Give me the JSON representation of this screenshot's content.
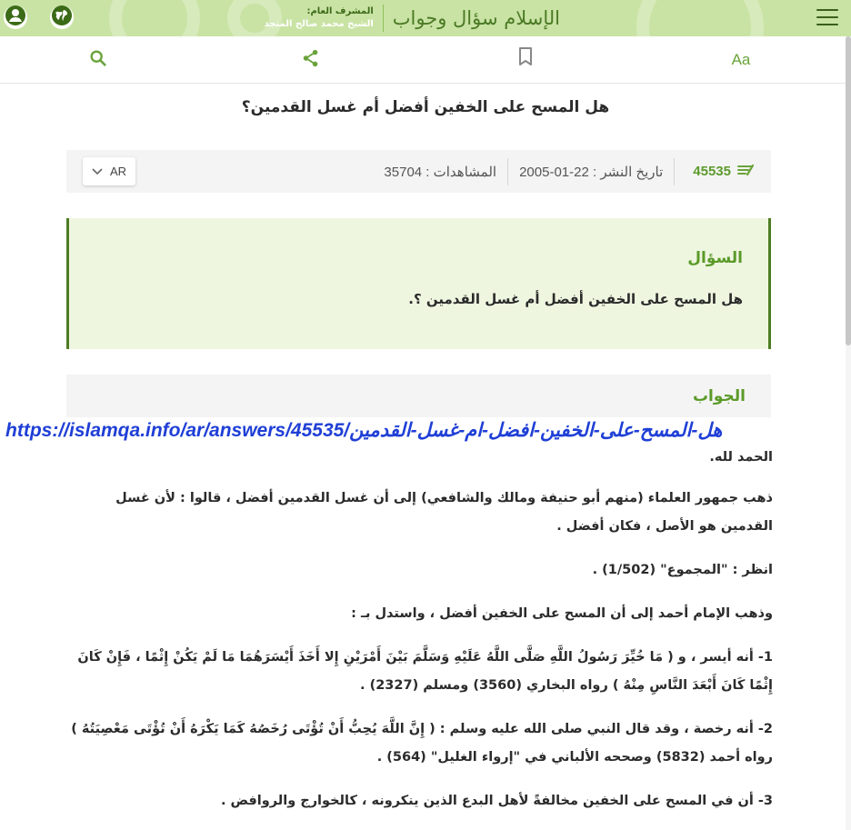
{
  "header": {
    "logo_text": "الإسلام سؤال وجواب",
    "supervisor_label": "المشرف العام:",
    "supervisor_name": "الشيخ محمد صالح المنجد"
  },
  "toolbar": {
    "font_size_label": "Aa"
  },
  "article": {
    "title": "هل المسح على الخفين أفضل أم غسل القدمين؟",
    "number": "45535",
    "publish_date": "تاريخ النشر : 22-01-2005",
    "views": "المشاهدات : 35704",
    "language": "AR"
  },
  "question": {
    "heading": "السؤال",
    "text": "هل المسح على الخفين أفضل أم غسل القدمين ؟."
  },
  "answer": {
    "heading": "الجواب",
    "url_overlay": "https://islamqa.info/ar/answers/45535/هل-المسح-على-الخفين-افضل-ام-غسل-القدمين",
    "paragraphs": [
      "الحمد لله.",
      "ذهب جمهور العلماء (منهم أبو حنيفة ومالك والشافعي) إلى أن غسل القدمين أفضل ، قالوا : لأن غسل القدمين هو الأصل ، فكان أفضل .",
      "انظر : \"المجموع\" (1/502) .",
      "وذهب الإمام أحمد إلى أن المسح على الخفين أفضل ، واستدل بـ :",
      "1- أنه أيسر ، و ( مَا خُيِّرَ رَسُولُ اللَّهِ صَلَّى اللَّهُ عَلَيْهِ وَسَلَّمَ بَيْنَ أَمْرَيْنِ إِلا أَخَذَ أَيْسَرَهُمَا مَا لَمْ يَكُنْ إِثْمًا ، فَإِنْ كَانَ إِثْمًا كَانَ أَبْعَدَ النَّاسِ مِنْهُ ) رواه البخاري (3560) ومسلم (2327) .",
      "2- أنه رخصة ، وقد قال النبي صلى الله عليه وسلم : ( إِنَّ اللَّهَ يُحِبُّ أَنْ تُؤْتَى رُخَصُهُ كَمَا يَكْرَهُ أَنْ تُؤْتَى مَعْصِيَتُهُ ) رواه أحمد (5832) وصححه الألباني في \"إرواء الغليل\" (564) .",
      "3- أن في المسح على الخفين مخالفةً لأهل البدع الذين ينكرونه ، كالخوارج والروافض ."
    ]
  },
  "colors": {
    "header_bg": "#c9e3a4",
    "accent_green": "#5a9a28",
    "question_bg": "#eef6e0",
    "url_blue": "#1f3fd6"
  }
}
